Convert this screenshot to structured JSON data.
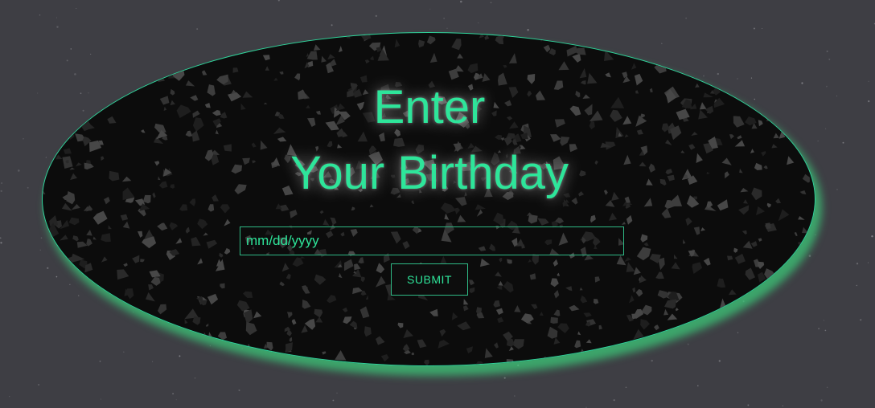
{
  "form": {
    "title_line1": "Enter",
    "title_line2": "Your Birthday",
    "date_placeholder": "mm/dd/yyyy",
    "submit_label": "SUBMIT"
  },
  "theme": {
    "accent": "#2ee59a",
    "page_background": "#3e3e44",
    "panel_background": "#0c0c0c"
  }
}
